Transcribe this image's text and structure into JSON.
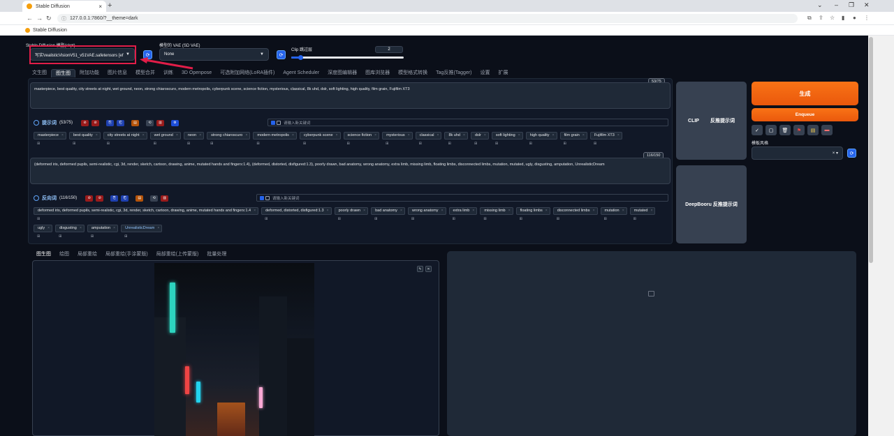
{
  "browser": {
    "tab_title": "Stable Diffusion",
    "url": "127.0.0.1:7860/?__theme=dark",
    "bookmark": "Stable Diffusion"
  },
  "top": {
    "ckpt_label": "Stable Diffusion 模型(ckpt)",
    "ckpt_value": "写实\\realisticVisionV51_v51VAE.safetensors [ef",
    "vae_label": "模型的 VAE (SD VAE)",
    "vae_value": "None",
    "clip_label": "Clip 跳过层",
    "clip_value": "2",
    "clip_fraction": 0.083
  },
  "tabs": [
    "文生图",
    "图生图",
    "附加功能",
    "图片信息",
    "模型合并",
    "训练",
    "3D Openpose",
    "可选附加网络(LoRA插件)",
    "Agent Scheduler",
    "深度图编辑器",
    "图库浏览器",
    "模型格式转换",
    "Tag反推(Tagger)",
    "设置",
    "扩展"
  ],
  "active_tab_index": 1,
  "prompt": {
    "text": "masterpiece, best quality, city streets at night, wet ground, neon, strong chiaroscuro, modern metropolis, cyberpunk scene, science fiction, mysterious, classical, 8k uhd, dslr, soft lighting, high quality, film grain, Fujifilm XT3",
    "count": "53/75",
    "section_title": "提示词",
    "section_count": "(53/75)",
    "tag_placeholder": "请输入新关键词",
    "tags": [
      "masterpiece",
      "best quality",
      "city streets at night",
      "wet ground",
      "neon",
      "strong chiaroscuro",
      "modern metropolis",
      "cyberpunk scene",
      "science fiction",
      "mysterious",
      "classical",
      "8k uhd",
      "dslr",
      "soft lighting",
      "high quality",
      "film grain",
      "Fujifilm XT3"
    ]
  },
  "negative": {
    "text": "(deformed iris, deformed pupils, semi-realistic, cgi, 3d, render, sketch, cartoon, drawing, anime, mutated hands and fingers:1.4), (deformed, distorted, disfigured:1.3), poorly drawn, bad anatomy, wrong anatomy, extra limb, missing limb, floating limbs, disconnected limbs, mutation, mutated, ugly, disgusting, amputation, UnrealisticDream",
    "count": "116/150",
    "section_title": "反向词",
    "section_count": "(116/150)",
    "tag_placeholder": "请输入新关键词",
    "tags": [
      "deformed iris, deformed pupils, semi-realistic, cgi, 3d, render, sketch, cartoon, drawing, anime, mutated hands and fingers:1.4",
      "deformed, distorted, disfigured:1.3",
      "poorly drawn",
      "bad anatomy",
      "wrong anatomy",
      "extra limb",
      "missing limb",
      "floating limbs",
      "disconnected limbs",
      "mutation",
      "mutated",
      "ugly",
      "disgusting",
      "amputation",
      "UnrealisticDream"
    ]
  },
  "tag_sub": "⊞",
  "buttons": {
    "clip": "CLIP",
    "clip_reverse": "反推提示词",
    "deepbooru": "DeepBooru 反推提示词",
    "generate": "生成",
    "enqueue": "Enqueue",
    "style_label": "模板风格"
  },
  "subtabs": [
    "图生图",
    "绘图",
    "局部重绘",
    "局部重绘(手涂蒙版)",
    "局部重绘(上传蒙版)",
    "批量处理"
  ],
  "colors": {
    "accent": "#f97316",
    "highlight": "#e11d48",
    "link": "#2563eb"
  }
}
